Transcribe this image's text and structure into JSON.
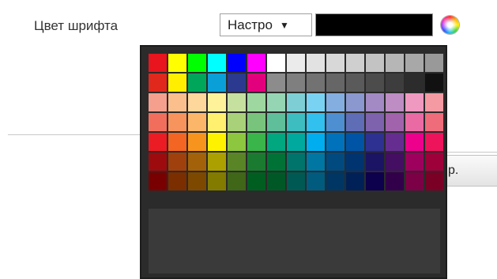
{
  "font_color": {
    "label": "Цвет шрифта",
    "preset_select": {
      "value": "Настро",
      "caret": "▼"
    },
    "current_color": "#000000",
    "picker_icon": "color-wheel-icon"
  },
  "background_button": {
    "label": "р."
  },
  "palette": {
    "rows": [
      [
        "#e8141e",
        "#ffff00",
        "#00ff00",
        "#00ffff",
        "#0000ff",
        "#ff00ff",
        "#ffffff",
        "#ebebeb",
        "#e2e2e2",
        "#d8d8d8",
        "#cfcfcf",
        "#c3c3c3",
        "#b6b6b6",
        "#a8a8a8",
        "#999999"
      ],
      [
        "#e0281d",
        "#ffee00",
        "#00a65a",
        "#0b9fd8",
        "#2b3a8f",
        "#e3007c",
        "#8c8c8c",
        "#7f7f7f",
        "#727272",
        "#666666",
        "#5a5a5a",
        "#4c4c4c",
        "#3d3d3d",
        "#2c2c2c",
        "#111111"
      ],
      [
        "#f5a08e",
        "#fbbf8e",
        "#fdd79b",
        "#fff29b",
        "#c6e0a0",
        "#9ed7a0",
        "#96d5b4",
        "#7dcfd5",
        "#7ad2f3",
        "#84aee0",
        "#8b97cf",
        "#a38ac4",
        "#bd8dc3",
        "#ef98c0",
        "#f59aa3"
      ],
      [
        "#f16e5d",
        "#f7935c",
        "#fcb66a",
        "#fff06f",
        "#a8d17a",
        "#79c47d",
        "#5fbf9b",
        "#3dbdc0",
        "#32c0ee",
        "#4e8fd2",
        "#5f6db7",
        "#7e62ae",
        "#a163ab",
        "#ea6aa4",
        "#ef6c7a"
      ],
      [
        "#ec1c24",
        "#f26522",
        "#f7941d",
        "#fff200",
        "#8dc63f",
        "#39b54a",
        "#00a77f",
        "#00a99d",
        "#00aeef",
        "#0072bc",
        "#0054a6",
        "#2e3192",
        "#662d91",
        "#ec008c",
        "#ed145b"
      ],
      [
        "#9e0b0f",
        "#a0410d",
        "#a36209",
        "#aba000",
        "#598527",
        "#1a7b30",
        "#007236",
        "#00746b",
        "#0076a3",
        "#004a80",
        "#003471",
        "#1b1464",
        "#440e62",
        "#9e005d",
        "#9e0039"
      ],
      [
        "#790000",
        "#7b2e00",
        "#7d4900",
        "#827b00",
        "#406618",
        "#005e20",
        "#005826",
        "#005952",
        "#005b7f",
        "#003663",
        "#002157",
        "#0d004c",
        "#32004b",
        "#7b0046",
        "#7a0026"
      ]
    ]
  }
}
